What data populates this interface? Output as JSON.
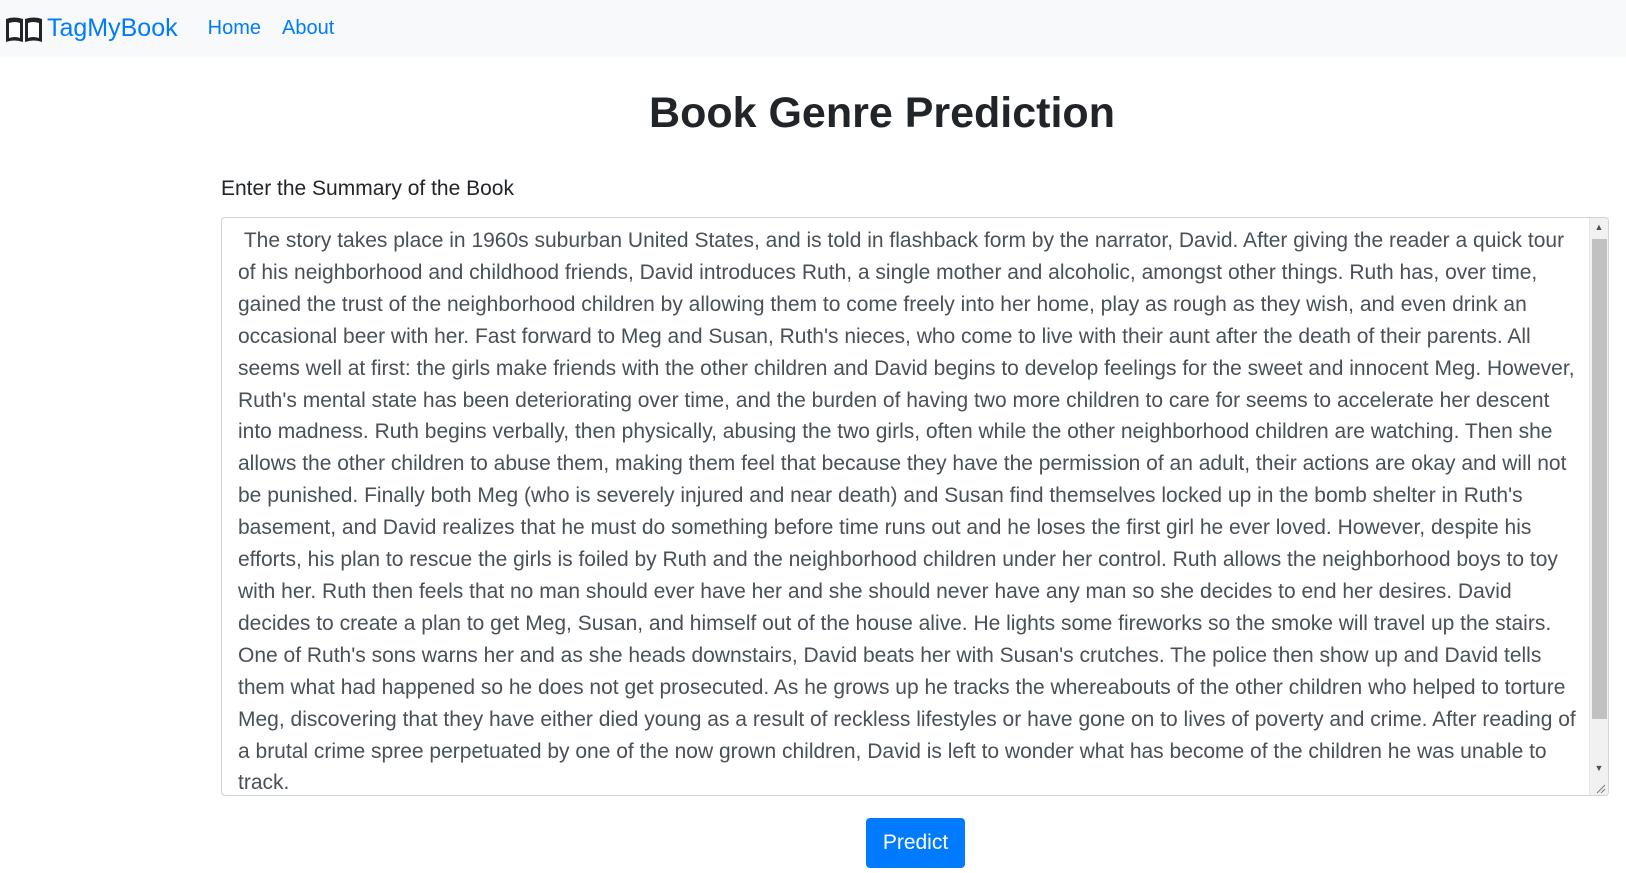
{
  "navbar": {
    "brand": "TagMyBook",
    "brand_icon": "open-book-icon",
    "links": [
      "Home",
      "About"
    ]
  },
  "page": {
    "title": "Book Genre Prediction"
  },
  "form": {
    "label": "Enter the Summary of the Book",
    "summary_value": " The story takes place in 1960s suburban United States, and is told in flashback form by the narrator, David. After giving the reader a quick tour of his neighborhood and childhood friends, David introduces Ruth, a single mother and alcoholic, amongst other things. Ruth has, over time, gained the trust of the neighborhood children by allowing them to come freely into her home, play as rough as they wish, and even drink an occasional beer with her. Fast forward to Meg and Susan, Ruth's nieces, who come to live with their aunt after the death of their parents. All seems well at first: the girls make friends with the other children and David begins to develop feelings for the sweet and innocent Meg. However, Ruth's mental state has been deteriorating over time, and the burden of having two more children to care for seems to accelerate her descent into madness. Ruth begins verbally, then physically, abusing the two girls, often while the other neighborhood children are watching. Then she allows the other children to abuse them, making them feel that because they have the permission of an adult, their actions are okay and will not be punished. Finally both Meg (who is severely injured and near death) and Susan find themselves locked up in the bomb shelter in Ruth's basement, and David realizes that he must do something before time runs out and he loses the first girl he ever loved. However, despite his efforts, his plan to rescue the girls is foiled by Ruth and the neighborhood children under her control. Ruth allows the neighborhood boys to toy with her. Ruth then feels that no man should ever have her and she should never have any man so she decides to end her desires. David decides to create a plan to get Meg, Susan, and himself out of the house alive. He lights some fireworks so the smoke will travel up the stairs. One of Ruth's sons warns her and as she heads downstairs, David beats her with Susan's crutches. The police then show up and David tells them what had happened so he does not get prosecuted. As he grows up he tracks the whereabouts of the other children who helped to torture Meg, discovering that they have either died young as a result of reckless lifestyles or have gone on to lives of poverty and crime. After reading of a brutal crime spree perpetuated by one of the now grown children, David is left to wonder what has become of the children he was unable to track.",
    "submit_label": "Predict"
  },
  "colors": {
    "brand": "#007bff",
    "navbar_bg": "#f8f9fa",
    "button_bg": "#007bff",
    "text": "#212529",
    "textarea_text": "#495057"
  }
}
